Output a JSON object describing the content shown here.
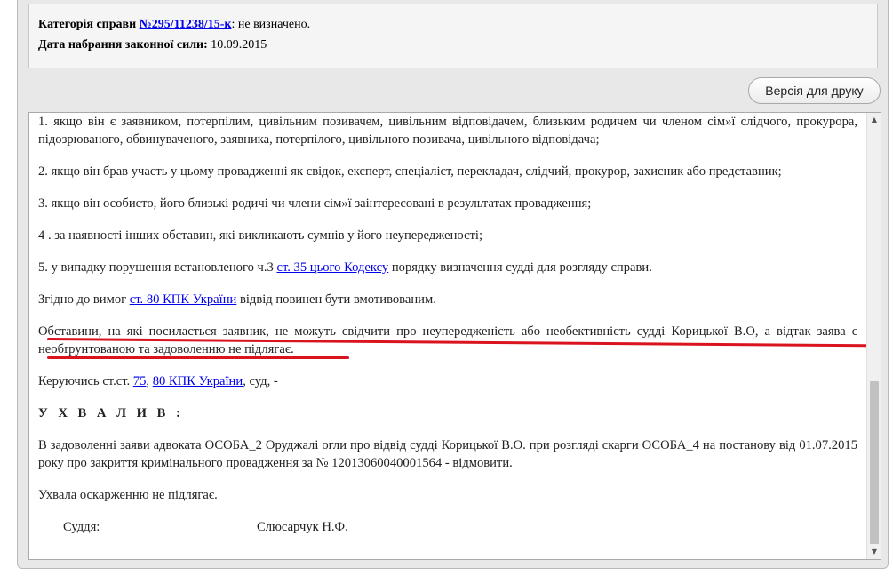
{
  "info": {
    "category_label": "Категорія справи",
    "case_link": "№295/11238/15-к",
    "category_value": ": не визначено.",
    "date_label": "Дата набрання законної сили:",
    "date_value": "10.09.2015"
  },
  "toolbar": {
    "print_label": "Версія для друку"
  },
  "doc": {
    "p1": "1. якщо він є заявником, потерпілим, цивільним позивачем, цивільним відповідачем, близьким родичем чи членом сім»ї слідчого, прокурора, підозрюваного, обвинуваченого, заявника, потерпілого, цивільного позивача, цивільного відповідача;",
    "p2": "2. якщо він брав участь у цьому провадженні як свідок, експерт, спеціаліст, перекладач, слідчий, прокурор, захисник або представник;",
    "p3": "3. якщо він особисто, його близькі родичі чи члени сім»ї заінтересовані в результатах провадження;",
    "p4": "4 . за наявності інших обставин, які викликають сумнів у його неупередженості;",
    "p5_a": "5. у випадку порушення встановленого ч.3 ",
    "p5_link": "ст. 35 цього Кодексу",
    "p5_b": " порядку визначення судді для розгляду справи.",
    "p6_a": "Згідно до вимог ",
    "p6_link": "ст. 80 КПК України",
    "p6_b": " відвід повинен бути вмотивованим.",
    "p7": "Обставини, на які посилається заявник, не можуть свідчити про неупередженість або необективність судді Корицької В.О, а відтак заява є необґрунтованою та задоволенню не підлягає.",
    "p8_a": "Керуючись ст.ст. ",
    "p8_link1": "75",
    "p8_sep": ", ",
    "p8_link2": "80 КПК України",
    "p8_b": ", суд, -",
    "heading": "У Х В А Л И В :",
    "p10": "В задоволенні заяви адвоката ОСОБА_2 Оруджалі огли про відвід судді Корицької В.О. при розгляді скарги ОСОБА_4 на постанову від 01.07.2015 року про закриття кримінального провадження за № 12013060040001564    - відмовити.",
    "p11": "Ухвала оскарженню не підлягає.",
    "judge_role": "Суддя:",
    "judge_name": "Слюсарчук Н.Ф."
  },
  "colors": {
    "highlight_underline": "#d9141f",
    "link": "#0000ee"
  }
}
